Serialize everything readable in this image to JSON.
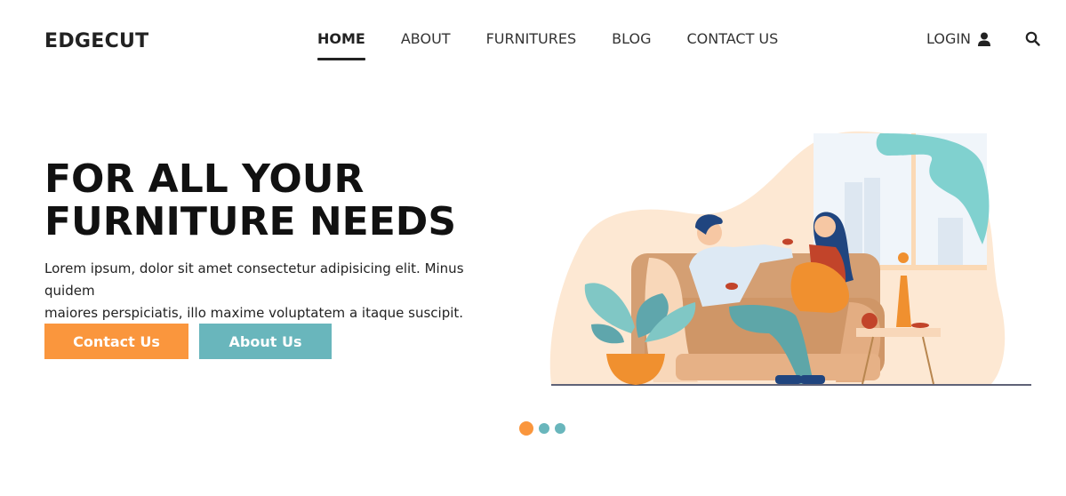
{
  "brand": {
    "name": "EDGECUT"
  },
  "nav": {
    "items": [
      {
        "label": "HOME",
        "active": true
      },
      {
        "label": "ABOUT",
        "active": false
      },
      {
        "label": "FURNITURES",
        "active": false
      },
      {
        "label": "BLOG",
        "active": false
      },
      {
        "label": "CONTACT US",
        "active": false
      }
    ],
    "login_label": "LOGIN",
    "login_icon": "user-icon",
    "search_icon": "search-icon"
  },
  "hero": {
    "title_line1": "FOR ALL YOUR",
    "title_line2": "FURNITURE NEEDS",
    "text_line1": "Lorem ipsum, dolor sit amet consectetur adipisicing elit. Minus quidem",
    "text_line2": "maiores perspiciatis, illo maxime voluptatem a itaque suscipit.",
    "contact_button": "Contact Us",
    "about_button": "About Us"
  },
  "carousel": {
    "slides": 3,
    "active_index": 0
  },
  "colors": {
    "accent_orange": "#fa963d",
    "accent_teal": "#69b6bc",
    "text_dark": "#222222"
  }
}
